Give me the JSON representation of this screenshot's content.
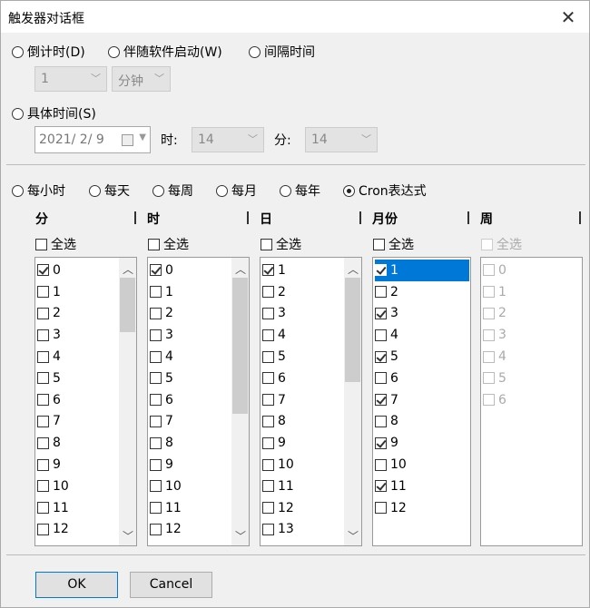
{
  "window": {
    "title": "触发器对话框"
  },
  "mode": {
    "countdown": "倒计时(D)",
    "with_app": "伴随软件启动(W)",
    "interval": "间隔时间",
    "interval_value": "1",
    "interval_unit": "分钟",
    "specific": "具体时间(S)",
    "date_value": "2021/  2/  9",
    "hour_label": "时:",
    "hour_value": "14",
    "minute_label": "分:",
    "minute_value": "14"
  },
  "schedule": {
    "hourly": "每小时",
    "daily": "每天",
    "weekly": "每周",
    "monthly": "每月",
    "yearly": "每年",
    "cron": "Cron表达式"
  },
  "columns": {
    "minute": "分",
    "hour": "时",
    "day": "日",
    "month": "月份",
    "week": "周",
    "select_all": "全选"
  },
  "lists": {
    "minute": [
      {
        "label": "0",
        "checked": true
      },
      {
        "label": "1",
        "checked": false
      },
      {
        "label": "2",
        "checked": false
      },
      {
        "label": "3",
        "checked": false
      },
      {
        "label": "4",
        "checked": false
      },
      {
        "label": "5",
        "checked": false
      },
      {
        "label": "6",
        "checked": false
      },
      {
        "label": "7",
        "checked": false
      },
      {
        "label": "8",
        "checked": false
      },
      {
        "label": "9",
        "checked": false
      },
      {
        "label": "10",
        "checked": false
      },
      {
        "label": "11",
        "checked": false
      },
      {
        "label": "12",
        "checked": false
      }
    ],
    "hour": [
      {
        "label": "0",
        "checked": true
      },
      {
        "label": "1",
        "checked": false
      },
      {
        "label": "2",
        "checked": false
      },
      {
        "label": "3",
        "checked": false
      },
      {
        "label": "4",
        "checked": false
      },
      {
        "label": "5",
        "checked": false
      },
      {
        "label": "6",
        "checked": false
      },
      {
        "label": "7",
        "checked": false
      },
      {
        "label": "8",
        "checked": false
      },
      {
        "label": "9",
        "checked": false
      },
      {
        "label": "10",
        "checked": false
      },
      {
        "label": "11",
        "checked": false
      },
      {
        "label": "12",
        "checked": false
      }
    ],
    "day": [
      {
        "label": "1",
        "checked": true
      },
      {
        "label": "2",
        "checked": false
      },
      {
        "label": "3",
        "checked": false
      },
      {
        "label": "4",
        "checked": false
      },
      {
        "label": "5",
        "checked": false
      },
      {
        "label": "6",
        "checked": false
      },
      {
        "label": "7",
        "checked": false
      },
      {
        "label": "8",
        "checked": false
      },
      {
        "label": "9",
        "checked": false
      },
      {
        "label": "10",
        "checked": false
      },
      {
        "label": "11",
        "checked": false
      },
      {
        "label": "12",
        "checked": false
      },
      {
        "label": "13",
        "checked": false
      }
    ],
    "month": [
      {
        "label": "1",
        "checked": true,
        "selected": true
      },
      {
        "label": "2",
        "checked": false
      },
      {
        "label": "3",
        "checked": true
      },
      {
        "label": "4",
        "checked": false
      },
      {
        "label": "5",
        "checked": true
      },
      {
        "label": "6",
        "checked": false
      },
      {
        "label": "7",
        "checked": true
      },
      {
        "label": "8",
        "checked": false
      },
      {
        "label": "9",
        "checked": true
      },
      {
        "label": "10",
        "checked": false
      },
      {
        "label": "11",
        "checked": true
      },
      {
        "label": "12",
        "checked": false
      }
    ],
    "week": [
      {
        "label": "0",
        "checked": false
      },
      {
        "label": "1",
        "checked": false
      },
      {
        "label": "2",
        "checked": false
      },
      {
        "label": "3",
        "checked": false
      },
      {
        "label": "4",
        "checked": false
      },
      {
        "label": "5",
        "checked": false
      },
      {
        "label": "6",
        "checked": false
      }
    ]
  },
  "buttons": {
    "ok": "OK",
    "cancel": "Cancel"
  }
}
